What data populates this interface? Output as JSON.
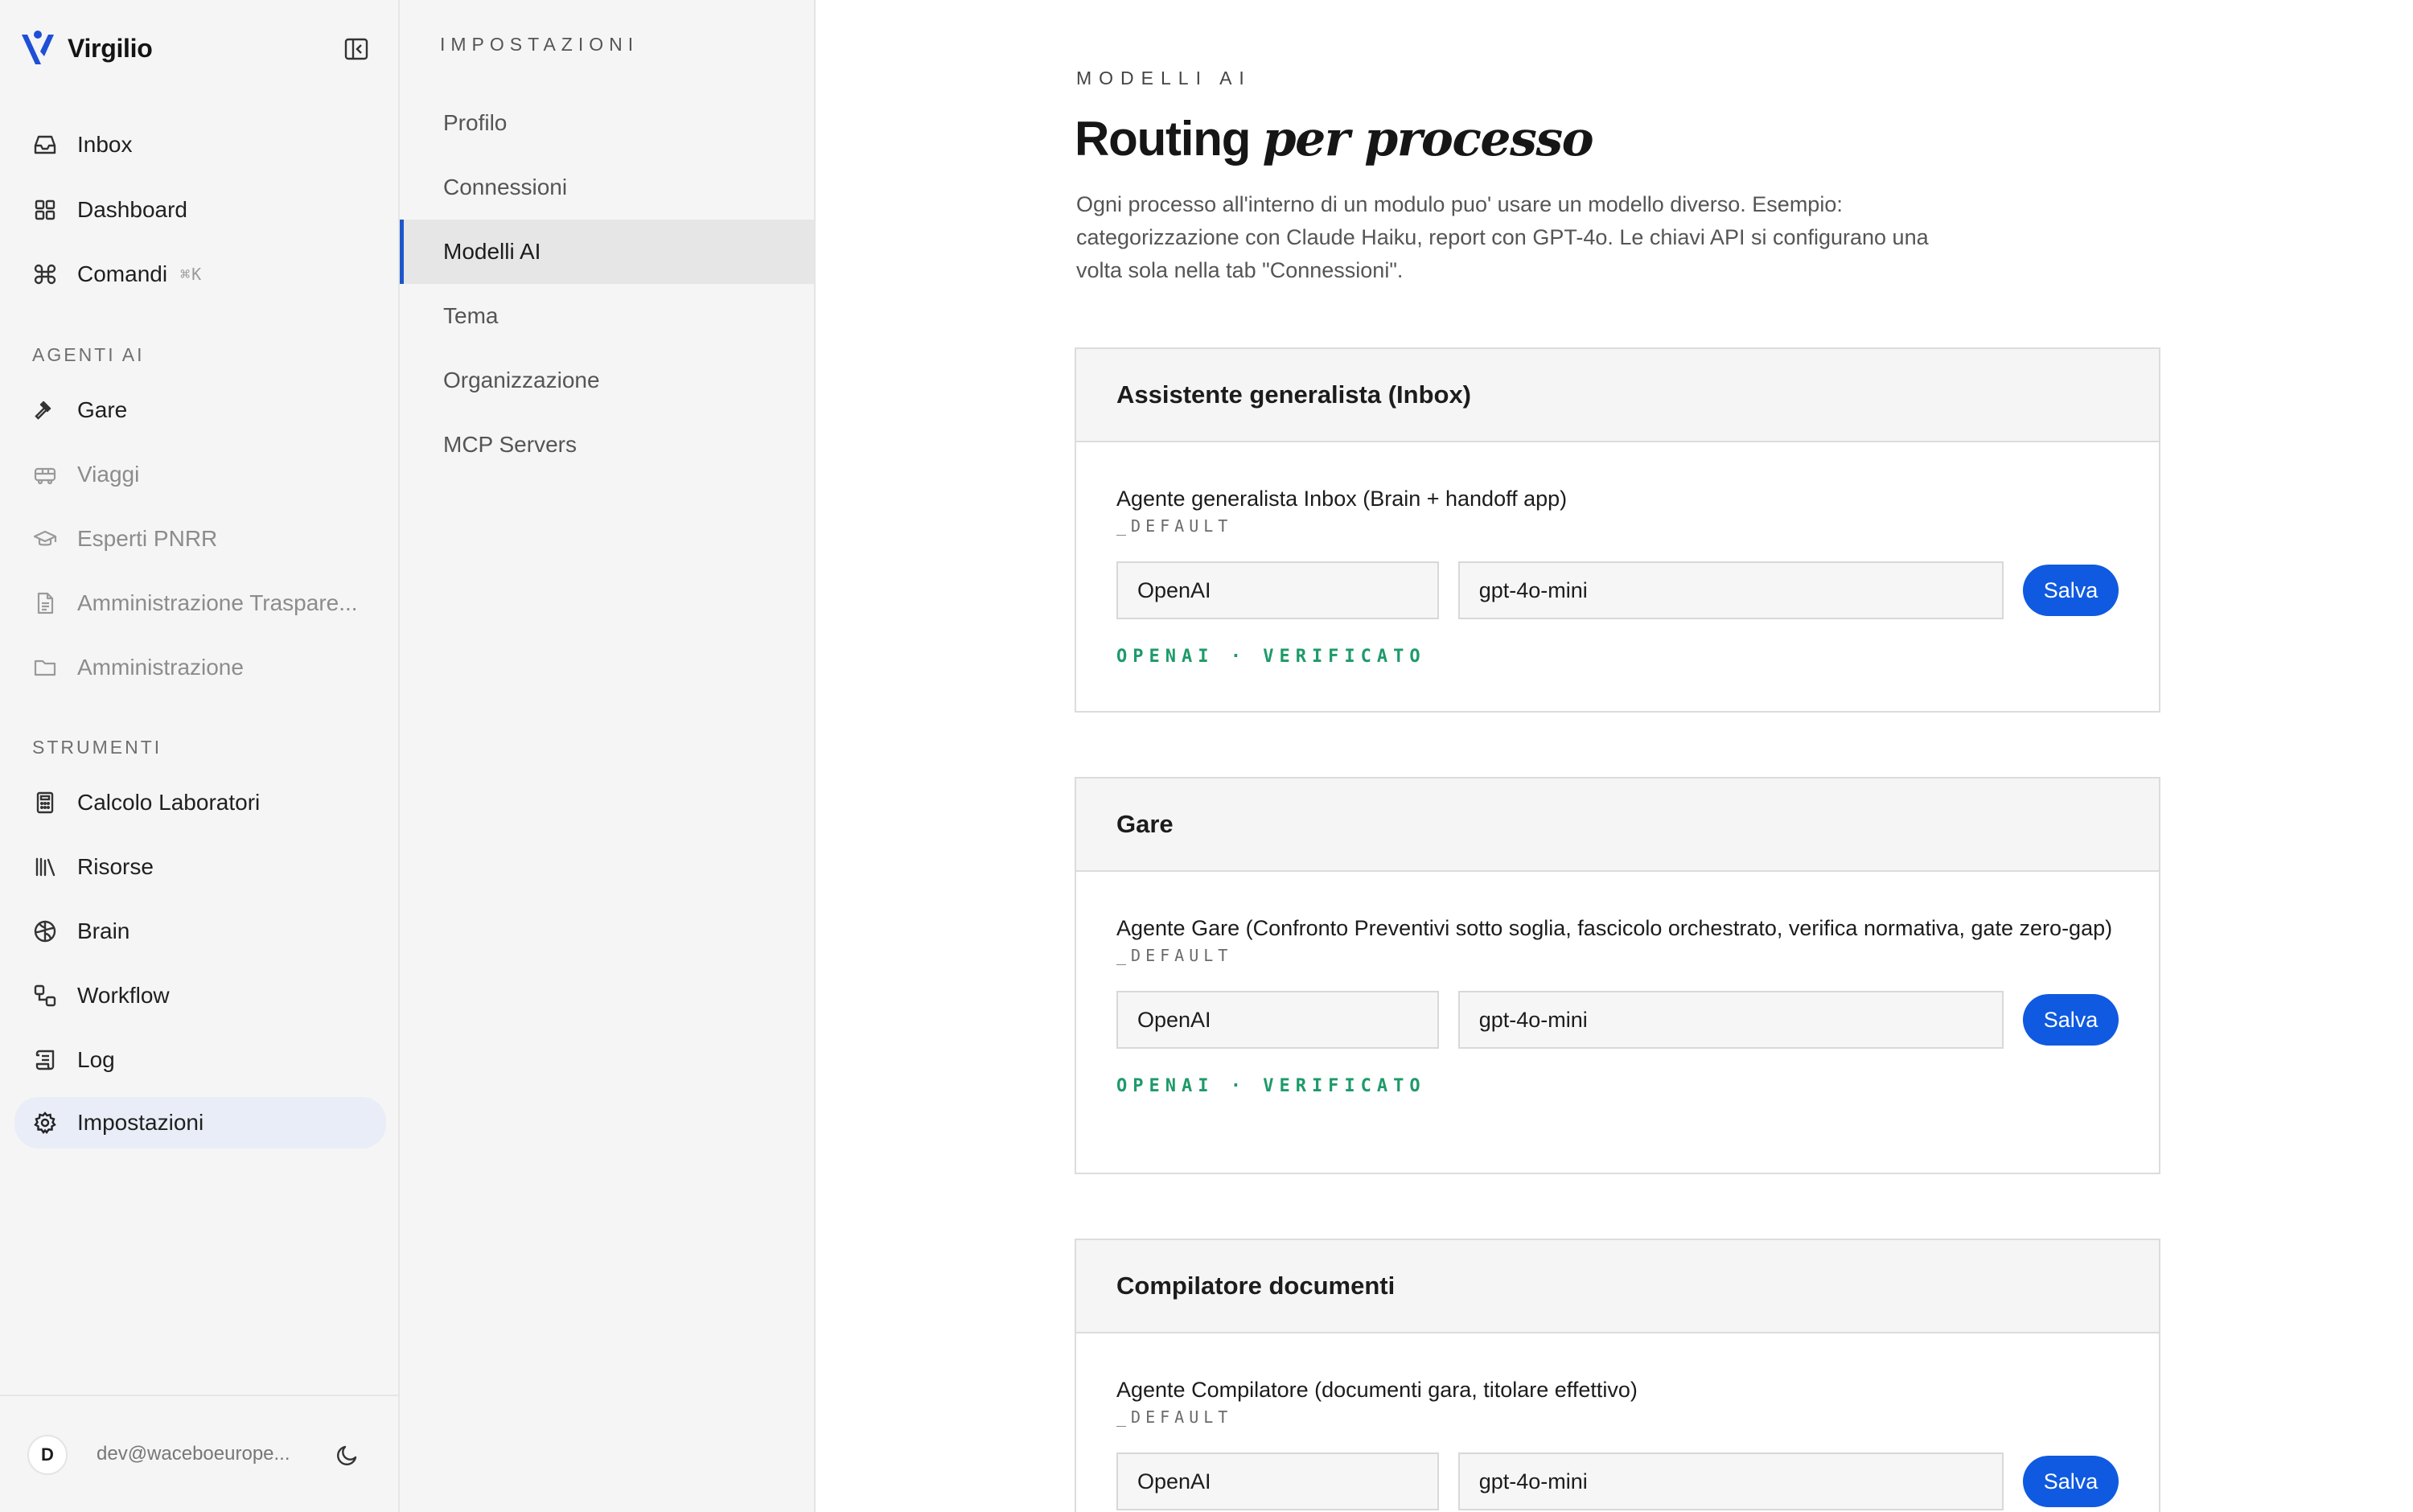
{
  "app": {
    "name": "Virgilio",
    "brand_color": "#1e4fd6"
  },
  "sidebar": {
    "main_items": [
      {
        "label": "Inbox",
        "icon": "inbox-icon"
      },
      {
        "label": "Dashboard",
        "icon": "grid-icon"
      },
      {
        "label": "Comandi",
        "icon": "command-icon",
        "shortcut": "⌘K"
      }
    ],
    "section_agents": "AGENTI AI",
    "agents": [
      {
        "label": "Gare",
        "icon": "gavel-icon"
      },
      {
        "label": "Viaggi",
        "icon": "bus-icon"
      },
      {
        "label": "Esperti PNRR",
        "icon": "graduation-cap-icon"
      },
      {
        "label": "Amministrazione Traspare...",
        "icon": "document-icon"
      },
      {
        "label": "Amministrazione",
        "icon": "folder-icon"
      }
    ],
    "section_tools": "STRUMENTI",
    "tools": [
      {
        "label": "Calcolo Laboratori",
        "icon": "calculator-icon"
      },
      {
        "label": "Risorse",
        "icon": "library-icon"
      },
      {
        "label": "Brain",
        "icon": "brain-icon"
      },
      {
        "label": "Workflow",
        "icon": "workflow-icon"
      },
      {
        "label": "Log",
        "icon": "scroll-icon"
      },
      {
        "label": "Impostazioni",
        "icon": "gear-icon"
      }
    ],
    "user": {
      "initial": "D",
      "email": "dev@waceboeurope..."
    }
  },
  "settings_nav": {
    "title": "IMPOSTAZIONI",
    "items": [
      {
        "label": "Profilo"
      },
      {
        "label": "Connessioni"
      },
      {
        "label": "Modelli AI"
      },
      {
        "label": "Tema"
      },
      {
        "label": "Organizzazione"
      },
      {
        "label": "MCP Servers"
      }
    ],
    "active": "Modelli AI"
  },
  "main": {
    "eyebrow": "MODELLI AI",
    "title_plain": "Routing",
    "title_italic": "per processo",
    "description": "Ogni processo all'interno di un modulo puo' usare un modello diverso. Esempio: categorizzazione con Claude Haiku, report con GPT-4o. Le chiavi API si configurano una volta sola nella tab \"Connessioni\".",
    "cards": [
      {
        "title": "Assistente generalista (Inbox)",
        "agent": "Agente generalista Inbox (Brain + handoff app)",
        "key": "_DEFAULT",
        "provider": "OpenAI",
        "model": "gpt-4o-mini",
        "button": "Salva",
        "status": "OPENAI · VERIFICATO"
      },
      {
        "title": "Gare",
        "agent": "Agente Gare (Confronto Preventivi sotto soglia, fascicolo orchestrato, verifica normativa, gate zero-gap)",
        "key": "_DEFAULT",
        "provider": "OpenAI",
        "model": "gpt-4o-mini",
        "button": "Salva",
        "status": "OPENAI · VERIFICATO"
      },
      {
        "title": "Compilatore documenti",
        "agent": "Agente Compilatore (documenti gara, titolare effettivo)",
        "key": "_DEFAULT",
        "provider": "OpenAI",
        "model": "gpt-4o-mini",
        "button": "Salva"
      }
    ]
  }
}
